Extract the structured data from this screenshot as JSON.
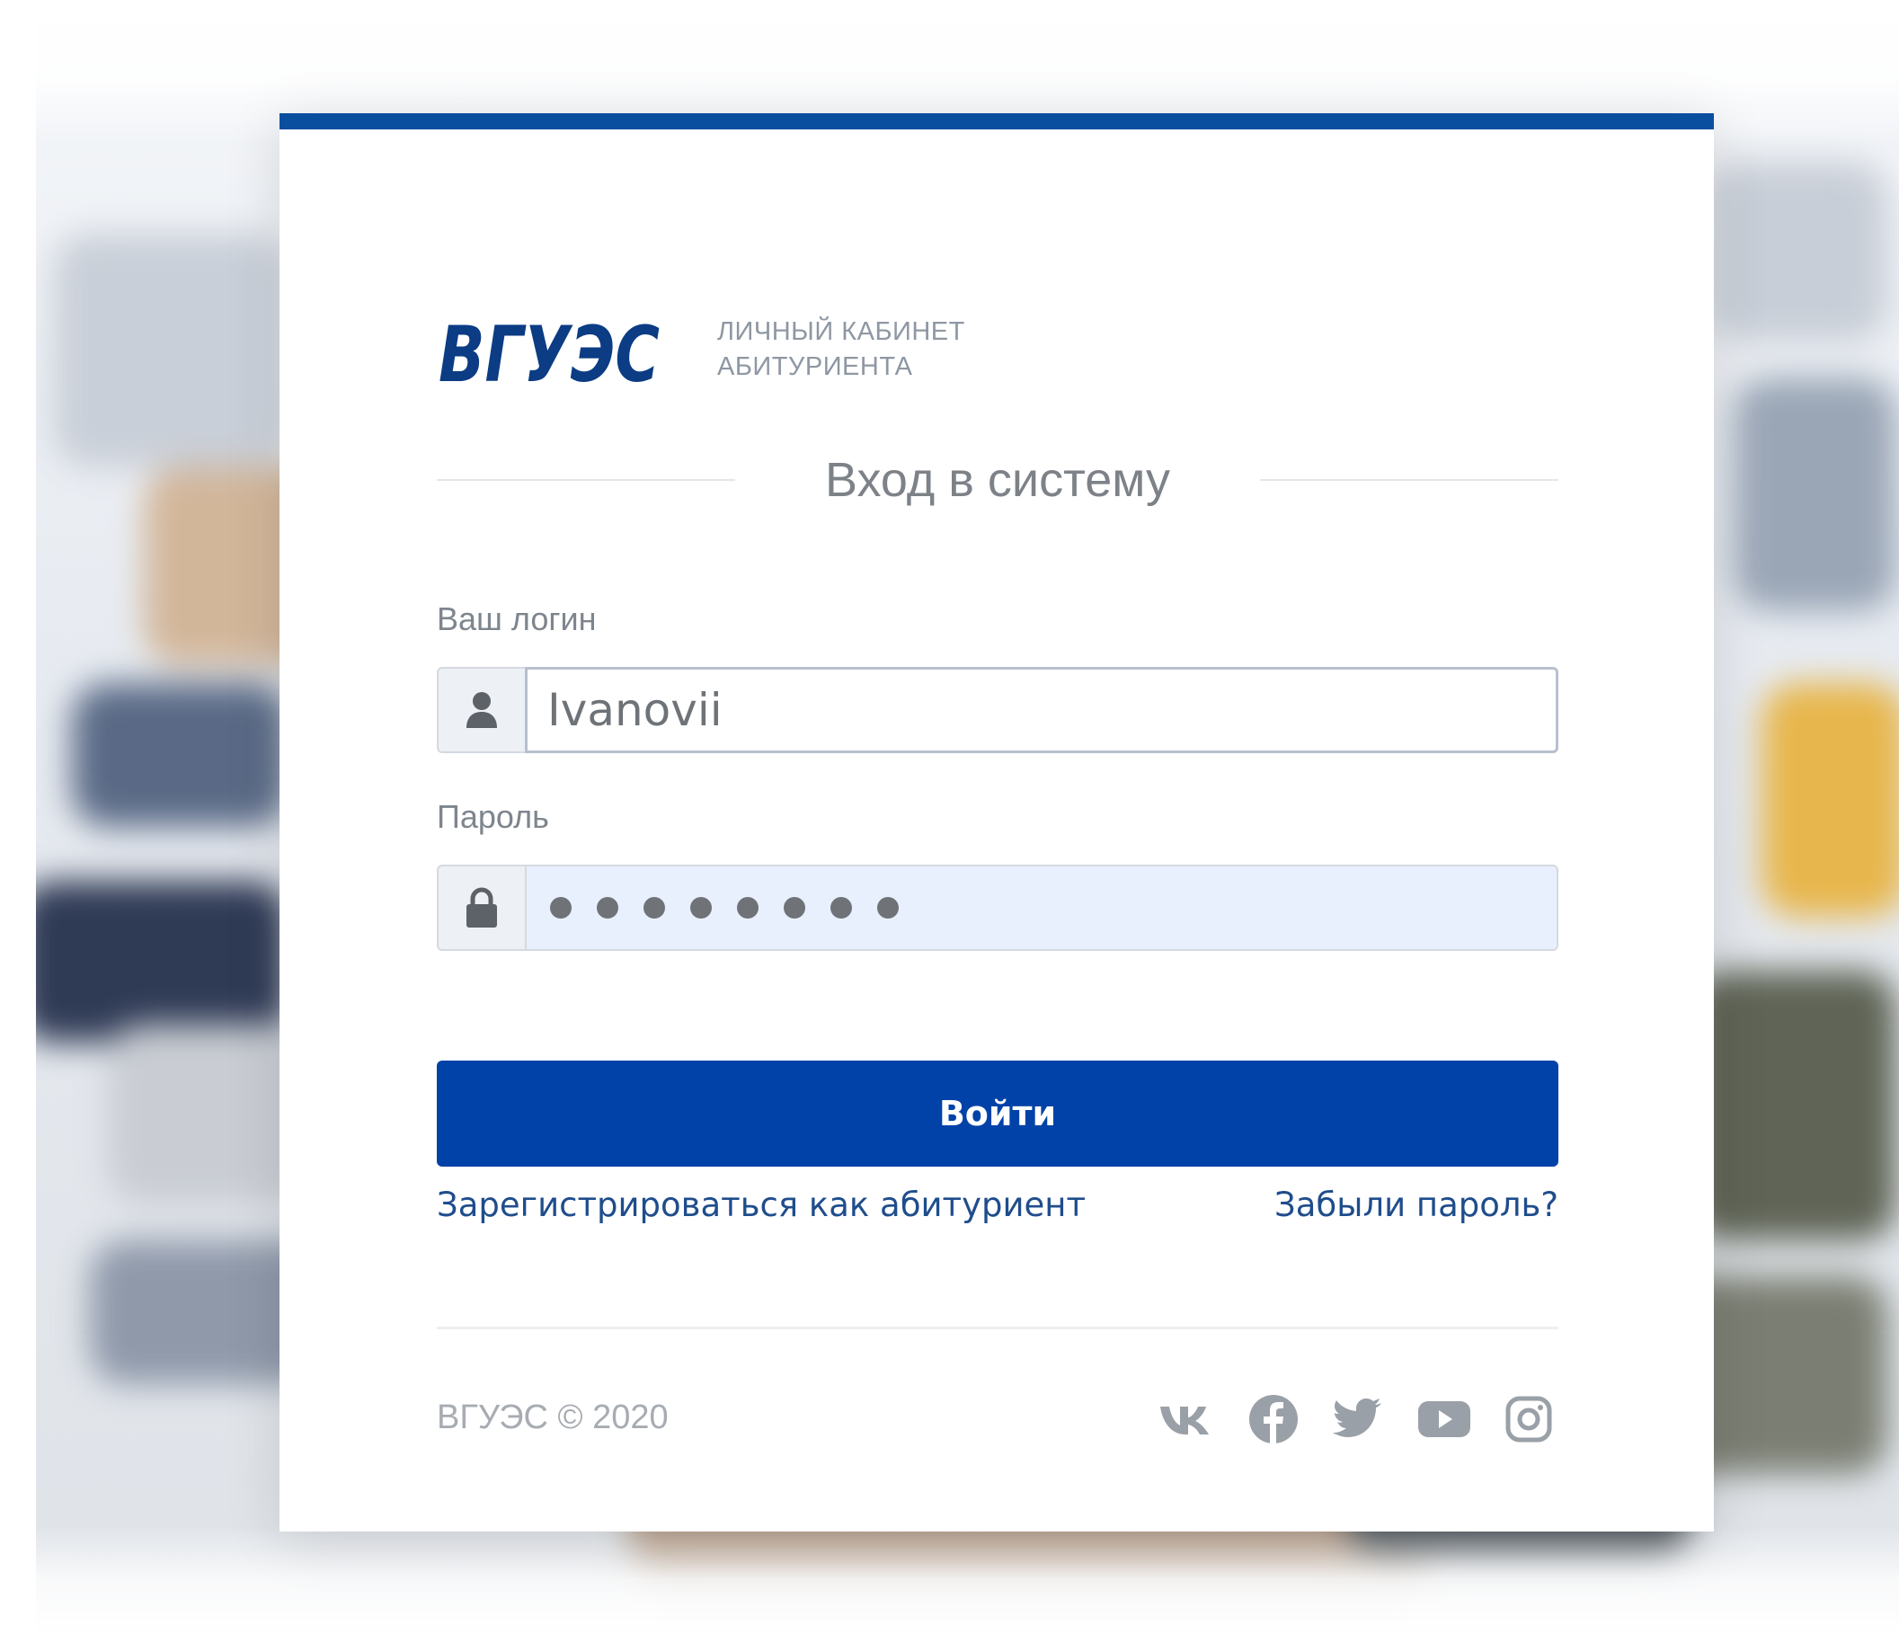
{
  "brand": {
    "logo_text": "ВГУЭС",
    "caption_line1": "ЛИЧНЫЙ КАБИНЕТ",
    "caption_line2": "АБИТУРИЕНТА",
    "accent_color": "#0a4ea0",
    "button_color": "#0042a8"
  },
  "login_form": {
    "title": "Вход в систему",
    "login_label": "Ваш логин",
    "login_value": "Ivanovii",
    "login_icon": "user-icon",
    "password_label": "Пароль",
    "password_masked_length": 8,
    "password_icon": "lock-icon",
    "submit_label": "Войти",
    "register_link": "Зарегистрироваться как абитуриент",
    "forgot_link": "Забыли пароль?"
  },
  "footer": {
    "copyright": "ВГУЭС © 2020",
    "social": [
      "vk-icon",
      "facebook-icon",
      "twitter-icon",
      "youtube-icon",
      "instagram-icon"
    ]
  }
}
